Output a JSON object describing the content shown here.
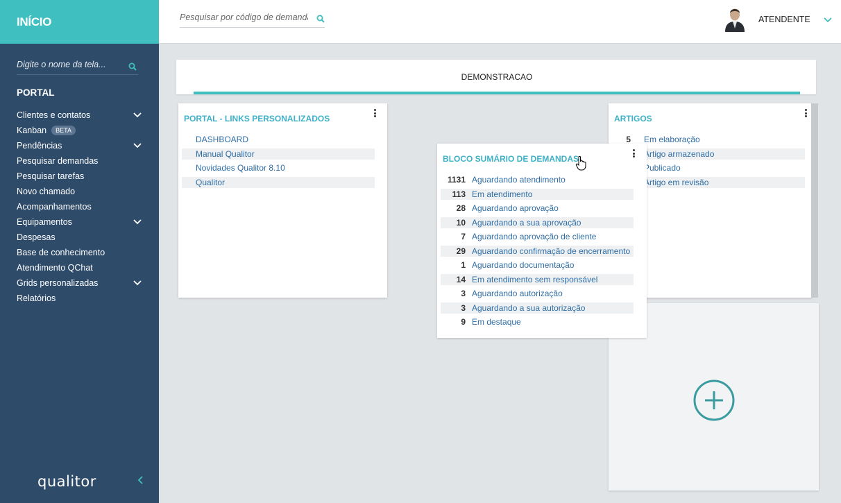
{
  "sidebar": {
    "title": "INÍCIO",
    "search_placeholder": "Digite o nome da tela...",
    "section_title": "PORTAL",
    "items": [
      {
        "label": "Clientes e contatos",
        "has_children": true
      },
      {
        "label": "Kanban",
        "badge": "BETA"
      },
      {
        "label": "Pendências",
        "has_children": true
      },
      {
        "label": "Pesquisar demandas"
      },
      {
        "label": "Pesquisar tarefas"
      },
      {
        "label": "Novo chamado"
      },
      {
        "label": "Acompanhamentos"
      },
      {
        "label": "Equipamentos",
        "has_children": true
      },
      {
        "label": "Despesas"
      },
      {
        "label": "Base de conhecimento"
      },
      {
        "label": "Atendimento QChat"
      },
      {
        "label": "Grids personalizadas",
        "has_children": true
      },
      {
        "label": "Relatórios"
      }
    ],
    "logo": "qualitor"
  },
  "header": {
    "search_placeholder": "Pesquisar por código de demanda",
    "user": "ATENDENTE"
  },
  "tabs": [
    {
      "label": "DEMONSTRACAO",
      "active": true
    }
  ],
  "cards": {
    "links": {
      "title": "PORTAL - LINKS PERSONALIZADOS",
      "items": [
        "DASHBOARD",
        "Manual Qualitor",
        "Novidades Qualitor 8.10",
        "Qualitor"
      ]
    },
    "artigos": {
      "title": "ARTIGOS",
      "items": [
        {
          "count": "5",
          "label": "Em elaboração"
        },
        {
          "count": "",
          "label": "Artigo armazenado"
        },
        {
          "count": "",
          "label": "Publicado"
        },
        {
          "count": "",
          "label": "Artigo em revisão"
        }
      ]
    },
    "sumario": {
      "title": "BLOCO SUMÁRIO DE DEMANDAS",
      "items": [
        {
          "count": "1131",
          "label": "Aguardando atendimento"
        },
        {
          "count": "113",
          "label": "Em atendimento"
        },
        {
          "count": "28",
          "label": "Aguardando aprovação"
        },
        {
          "count": "10",
          "label": "Aguardando a sua aprovação"
        },
        {
          "count": "7",
          "label": "Aguardando aprovação de cliente"
        },
        {
          "count": "29",
          "label": "Aguardando confirmação de encerramento"
        },
        {
          "count": "1",
          "label": "Aguardando documentação"
        },
        {
          "count": "14",
          "label": "Em atendimento sem responsável"
        },
        {
          "count": "3",
          "label": "Aguardando autorização"
        },
        {
          "count": "3",
          "label": "Aguardando a sua autorização"
        },
        {
          "count": "9",
          "label": "Em destaque"
        }
      ]
    }
  },
  "colors": {
    "accent": "#3fbfc0",
    "sidebar_bg": "#2e4b6a",
    "link": "#2f6ea5",
    "card_title": "#3eb1c7"
  }
}
